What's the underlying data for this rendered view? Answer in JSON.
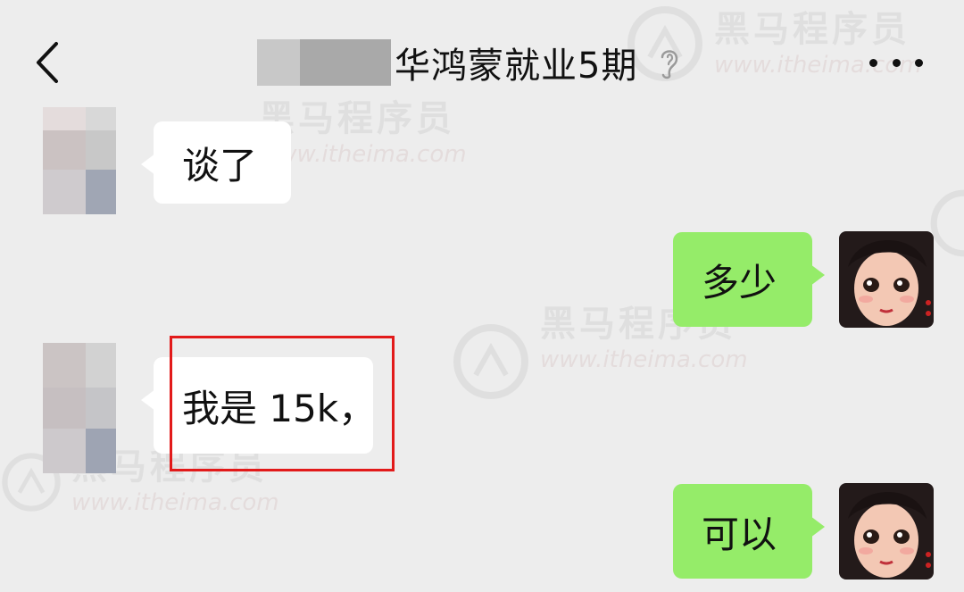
{
  "header": {
    "back_icon": "chevron-left-icon",
    "title": "华鸿蒙就业5期",
    "ear_icon": "earpiece-mode-icon",
    "more_icon": "more-dots-icon"
  },
  "watermark": {
    "brand": "黑马程序员",
    "url": "www.itheima.com"
  },
  "messages": [
    {
      "side": "in",
      "text": "谈了"
    },
    {
      "side": "out",
      "text": "多少"
    },
    {
      "side": "in",
      "text": "我是 15k，"
    },
    {
      "side": "out",
      "text": "可以"
    }
  ],
  "colors": {
    "background": "#ededed",
    "incoming_bubble": "#ffffff",
    "outgoing_bubble": "#95ec69",
    "highlight": "#e21a1a"
  }
}
